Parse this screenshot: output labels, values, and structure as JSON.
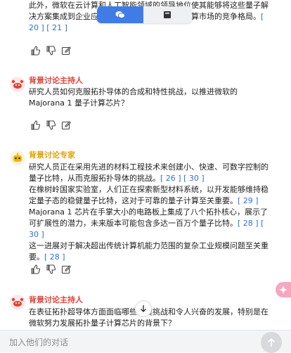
{
  "top_toggle": {
    "left_icon": "chat-bubbles-icon",
    "right_icon": "book-icon",
    "left_color": "#3f7ce6"
  },
  "messages": [
    {
      "text": "此外，微软在云计算和人工智能领域的领导地位使其能够将这些量子解决方案集成到企业应用中，进一步增强在量子计算市场的竞争格局。",
      "refs": "[ 20 ] [ 21 ]"
    },
    {
      "name": "背景讨论主持人",
      "name_color": "#e0453c",
      "avatar_icon": "crab-icon",
      "text": "研究人员如何克服拓扑导体的合成和特性挑战，以推进微软的 Majorana 1 量子计算芯片？"
    },
    {
      "name": "背景讨论专家",
      "name_color": "#e5a100",
      "avatar_icon": "robot-icon",
      "text": "研究人员正在采用先进的材料工程技术来创建小、快速、可数字控制的量子比特，从而克服拓扑导体的挑战。",
      "refs": "[ 26 ] [ 30 ]",
      "text2": "在橡树岭国家实验室，人们正在探索新型材料系统，以开发能够维持稳定量子态的稳健量子比特，这对于可靠的量子计算至关重要。",
      "refs2": "[ 29 ]",
      "text3": "Majorana 1 芯片在手掌大小的电路板上集成了八个拓扑核心，展示了可扩展性的潜力，未来版本可能包含多达一百万个量子比特。",
      "refs3": "[ 28 ] [ 30 ]",
      "text4": "这一进展对于解决超出传统计算机能力范围的复杂工业规模问题至关重要。",
      "refs4": "[ 28 ]"
    },
    {
      "name": "背景讨论主持人",
      "name_color": "#e0453c",
      "avatar_icon": "crab-icon",
      "text": "在表征拓扑超导体方面面临哪些关键挑战和令人兴奋的发展，特别是在微软努力发展拓扑量子计算芯片的背景下？"
    }
  ],
  "actions": [
    "thumbs-up-icon",
    "thumbs-down-icon",
    "edit-icon"
  ],
  "input": {
    "placeholder": "加入他们的对话"
  },
  "send_icon": "arrow-up-icon",
  "scroll_down_icon": "chevron-down-icon"
}
